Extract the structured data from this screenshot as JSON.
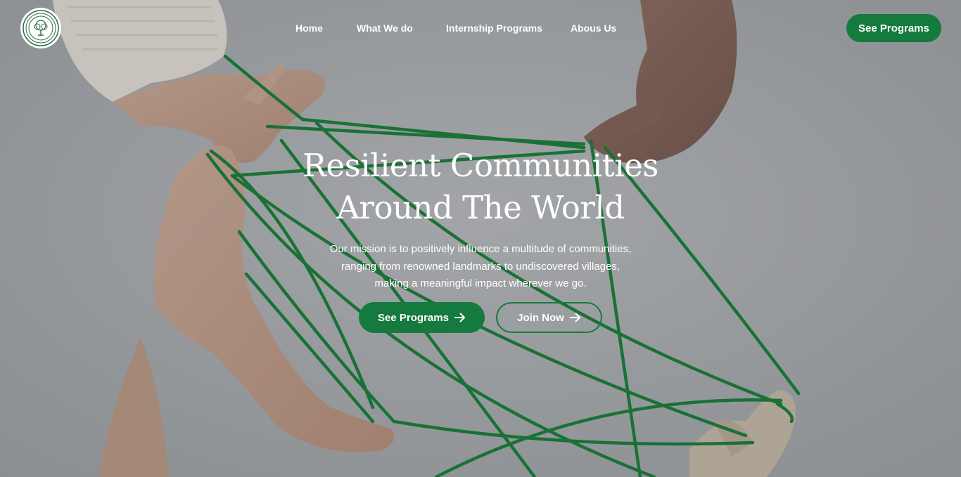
{
  "header": {
    "logo_icon": "tree-rings-logo-icon",
    "nav": [
      {
        "label": "Home"
      },
      {
        "label": "What We do"
      },
      {
        "label": "Internship Programs"
      },
      {
        "label": "Abous Us"
      }
    ],
    "cta_label": "See Programs"
  },
  "hero": {
    "title_line1": "Resilient Communities",
    "title_line2": "Around The World",
    "subtitle_line1": "Our mission is to positively influence a multitude of communities,",
    "subtitle_line2": "ranging from renowned landmarks to undiscovered villages,",
    "subtitle_line3": "making a meaningful impact wherever we go.",
    "primary_button": {
      "label": "See Programs",
      "icon": "arrow-right-icon"
    },
    "secondary_button": {
      "label": "Join Now",
      "icon": "arrow-right-icon"
    }
  },
  "colors": {
    "brand_green": "#157a3d",
    "background_gray": "#a9adb1",
    "text_white": "#ffffff"
  }
}
